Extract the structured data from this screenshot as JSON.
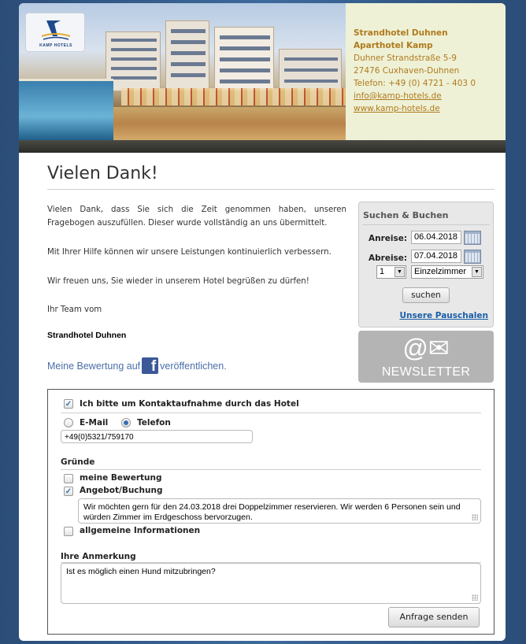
{
  "header": {
    "logo_text": "KAMP HOTELS",
    "info_lines": [
      "Strandhotel Duhnen",
      "Aparthotel Kamp",
      "Duhner Strandstraße 5-9",
      "27476 Cuxhaven-Duhnen",
      "Telefon: +49 (0) 4721 - 403 0"
    ],
    "email": "info@kamp-hotels.de",
    "website": "www.kamp-hotels.de"
  },
  "main": {
    "title": "Vielen Dank!",
    "paragraphs": [
      "Vielen Dank, dass Sie sich die Zeit genommen haben, unseren Fragebogen auszufüllen. Dieser wurde vollständig an uns übermittelt.",
      "Mit Ihrer Hilfe können wir unsere Leistungen kontinuierlich verbessern.",
      "Wir freuen uns, Sie wieder in unserem Hotel begrüßen zu dürfen!",
      "Ihr Team vom"
    ],
    "hotel_name": "Strandhotel Duhnen",
    "facebook_prefix": "Meine Bewertung auf",
    "facebook_suffix": "veröffentlichen.",
    "facebook_icon": "f"
  },
  "search": {
    "title": "Suchen & Buchen",
    "arrival_label": "Anreise:",
    "arrival_value": "06.04.2018",
    "departure_label": "Abreise:",
    "departure_value": "07.04.2018",
    "rooms_count": "1",
    "room_type": "Einzelzimmer",
    "search_button": "suchen",
    "packages_link": "Unsere Pauschalen"
  },
  "newsletter": {
    "label": "NEWSLETTER",
    "icons": "@✉"
  },
  "form": {
    "contact_label": "Ich bitte um Kontaktaufnahme durch das Hotel",
    "contact_checked": true,
    "email_option": "E-Mail",
    "phone_option": "Telefon",
    "selected_option": "Telefon",
    "phone_value": "+49(0)5321/759170",
    "reasons_heading": "Gründe",
    "reasons": [
      {
        "label": "meine Bewertung",
        "checked": false
      },
      {
        "label": "Angebot/Buchung",
        "checked": true
      },
      {
        "label": "allgemeine Informationen",
        "checked": false
      }
    ],
    "booking_text": "Wir möchten gern für den 24.03.2018 drei Doppelzimmer reservieren. Wir werden 6 Personen sein und würden Zimmer im Erdgeschoss bervorzugen.",
    "remark_heading": "Ihre Anmerkung",
    "remark_text": "Ist es möglich einen Hund mitzubringen?",
    "submit_button": "Anfrage senden"
  },
  "colors": {
    "page_background": "#2b4d78",
    "header_text": "#b07a1e",
    "link": "#1a5ea8",
    "facebook": "#3b5998"
  }
}
